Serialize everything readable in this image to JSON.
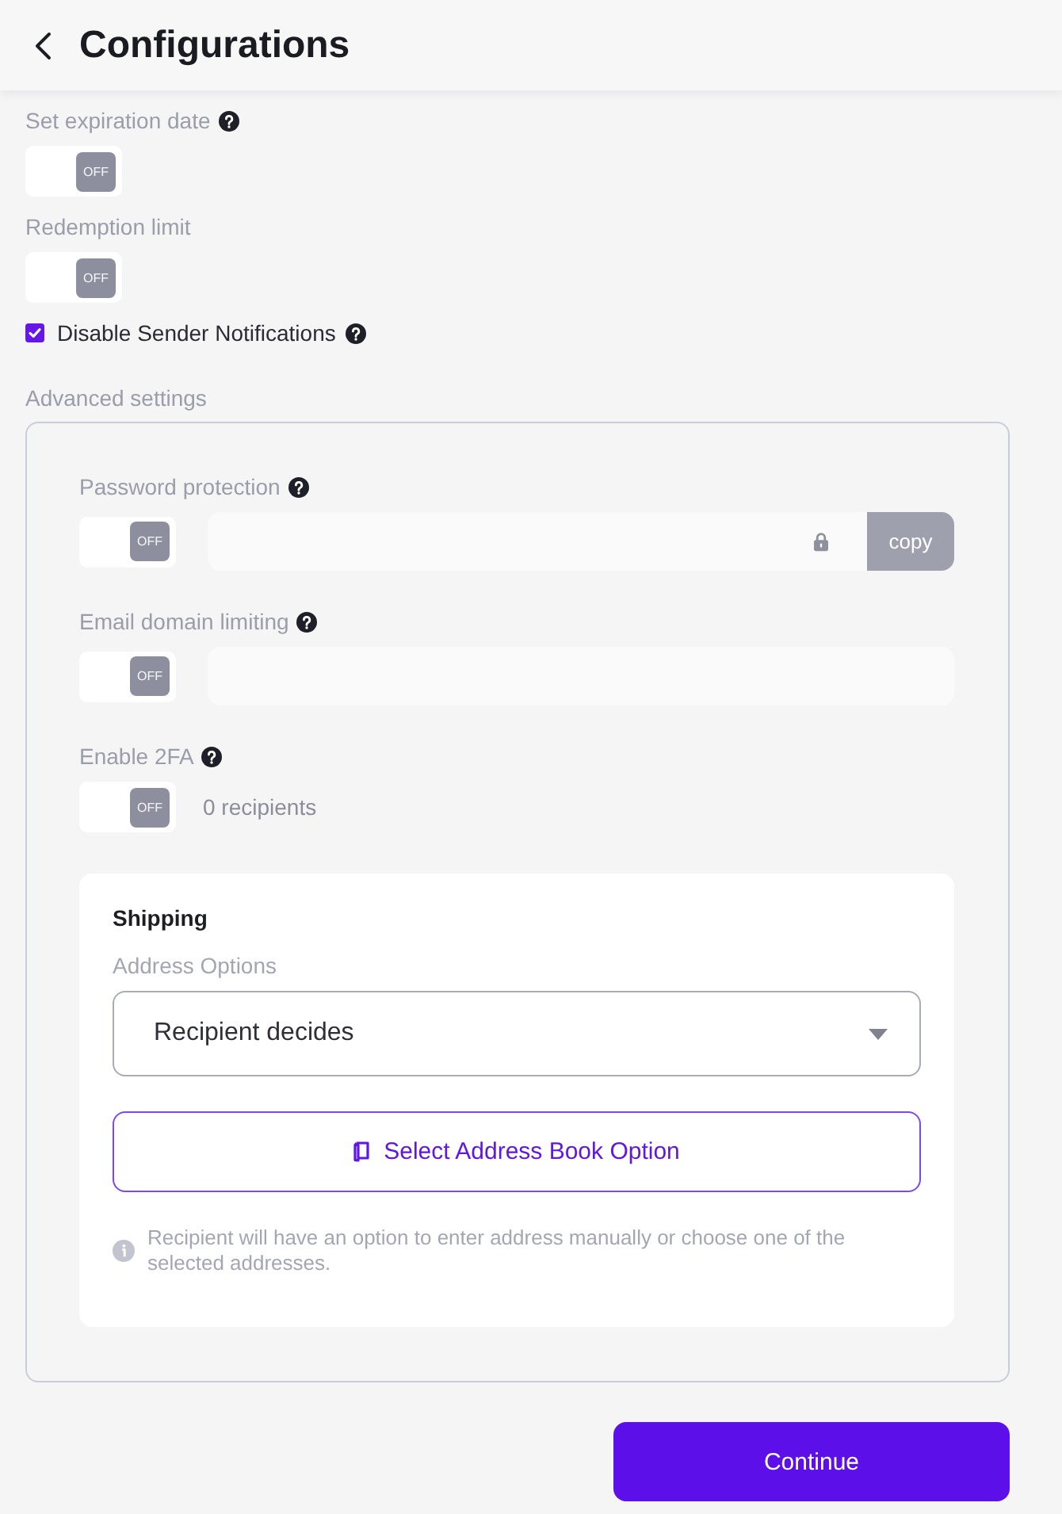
{
  "header": {
    "title": "Configurations"
  },
  "settings": [
    {
      "kind": "toggle",
      "label": "Set expiration date",
      "help": true,
      "toggle": {
        "on": false,
        "text": "OFF"
      }
    },
    {
      "kind": "toggle",
      "label": "Redemption limit",
      "help": false,
      "toggle": {
        "on": false,
        "text": "OFF"
      }
    },
    {
      "kind": "checkbox",
      "label": "Disable Sender Notifications",
      "help": true,
      "checked": true
    }
  ],
  "advanced": {
    "title": "Advanced settings",
    "items": [
      {
        "kind": "password",
        "label": "Password protection",
        "help": true,
        "toggle": {
          "on": false,
          "text": "OFF"
        },
        "copy_button": {
          "label": "copy",
          "disabled": true
        }
      },
      {
        "kind": "text",
        "label": "Email domain limiting",
        "help": true,
        "toggle": {
          "on": false,
          "text": "OFF"
        }
      },
      {
        "kind": "count",
        "label": "Enable 2FA",
        "help": true,
        "toggle": {
          "on": false,
          "text": "OFF"
        },
        "count": "0 recipients"
      }
    ],
    "shipping": {
      "title": "Shipping",
      "field_label": "Address Options",
      "select_value": "Recipient decides",
      "address_book_button": "Select Address Book Option",
      "note": "Recipient will have an option to enter address manually or choose one of the selected addresses."
    }
  },
  "continue_button": "Continue"
}
